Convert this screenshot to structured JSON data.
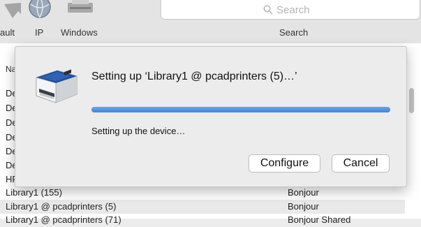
{
  "toolbar": {
    "tabs": [
      {
        "label": "ault",
        "icon": "default-printer-icon"
      },
      {
        "label": "IP",
        "icon": "globe-icon"
      },
      {
        "label": "Windows",
        "icon": "windows-printer-icon"
      }
    ],
    "search": {
      "placeholder": "Search",
      "label": "Search",
      "icon": "magnifier-icon"
    }
  },
  "list": {
    "header_fragment": "Na",
    "left_fragments": [
      "De",
      "De",
      "De",
      "De",
      "De",
      "De",
      "HF"
    ],
    "rows": [
      {
        "name": "Library1 (155)",
        "kind": "Bonjour"
      },
      {
        "name": "Library1 @ pcadprinters (5)",
        "kind": "Bonjour"
      },
      {
        "name": "Library1 @ pcadprinters (71)",
        "kind": "Bonjour Shared"
      }
    ]
  },
  "dialog": {
    "icon": "printer-icon",
    "title": "Setting up ‘Library1 @ pcadprinters (5)…’",
    "progress": 1.0,
    "status": "Setting up the device…",
    "buttons": {
      "configure": "Configure",
      "cancel": "Cancel"
    }
  },
  "colors": {
    "progress_fill": "#3d86de",
    "printer_top": "#1f4f9a",
    "sheet_bg": "#ececec"
  }
}
